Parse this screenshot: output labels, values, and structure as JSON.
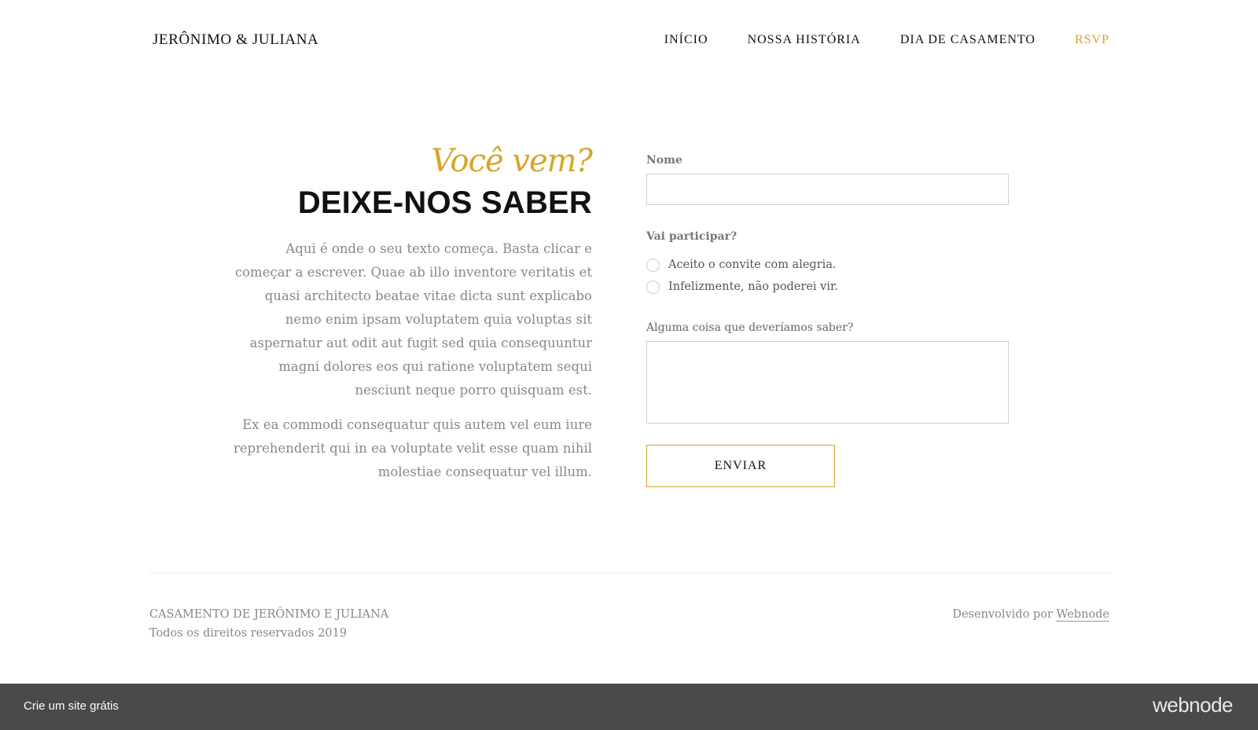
{
  "header": {
    "logo": "JERÔNIMO & JULIANA",
    "nav": [
      {
        "label": "INÍCIO"
      },
      {
        "label": "NOSSA HISTÓRIA"
      },
      {
        "label": "DIA DE CASAMENTO"
      },
      {
        "label": "RSVP"
      }
    ],
    "active_nav": "RSVP"
  },
  "intro": {
    "script_title": "Você vem?",
    "heading": "DEIXE-NOS SABER",
    "paragraph_1": "Aqui é onde o seu texto começa. Basta clicar e começar a escrever. Quae ab illo inventore veritatis et quasi architecto beatae vitae dicta sunt explicabo nemo enim ipsam voluptatem quia voluptas sit aspernatur aut odit aut fugit sed quia consequuntur magni dolores eos qui ratione voluptatem sequi nesciunt neque porro quisquam est.",
    "paragraph_2": "Ex ea commodi consequatur quis autem vel eum iure reprehenderit qui in ea voluptate velit esse quam nihil molestiae consequatur vel illum."
  },
  "form": {
    "name_label": "Nome",
    "name_value": "",
    "attend_label": "Vai participar?",
    "options": [
      {
        "label": "Aceito o convite com alegria."
      },
      {
        "label": "Infelizmente, não poderei vir."
      }
    ],
    "notes_label": "Alguma coisa que deveríamos saber?",
    "notes_value": "",
    "submit_label": "ENVIAR"
  },
  "footer": {
    "line_1": "CASAMENTO DE JERÔNIMO E JULIANA",
    "line_2": "Todos os direitos reservados 2019",
    "credit_prefix": "Desenvolvido por ",
    "credit_link": "Webnode"
  },
  "bottom_bar": {
    "link": "Crie um site grátis",
    "brand": "webnode"
  },
  "colors": {
    "accent": "#d8a42a",
    "bar_bg": "#4a4a4a"
  }
}
